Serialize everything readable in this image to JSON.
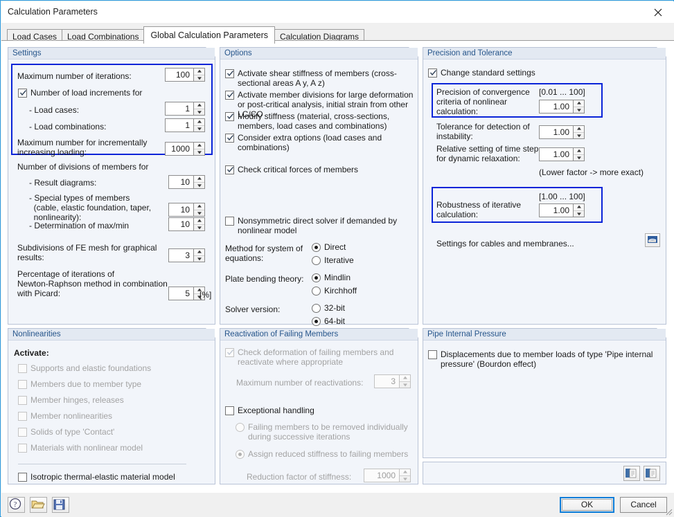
{
  "window": {
    "title": "Calculation Parameters",
    "close_icon": "close-icon"
  },
  "tabs": [
    {
      "label": "Load Cases",
      "active": false
    },
    {
      "label": "Load Combinations",
      "active": false
    },
    {
      "label": "Global Calculation Parameters",
      "active": true
    },
    {
      "label": "Calculation Diagrams",
      "active": false
    }
  ],
  "settings": {
    "title": "Settings",
    "max_iterations_label": "Maximum number of iterations:",
    "max_iterations_value": "100",
    "load_increments_label": "Number of load increments for",
    "load_increments_checked": true,
    "load_cases_label": "- Load cases:",
    "load_cases_value": "1",
    "load_combinations_label": "- Load combinations:",
    "load_combinations_value": "1",
    "max_incremental_label": "Maximum number for incrementally\nincreasing loading:",
    "max_incremental_value": "1000",
    "divisions_label": "Number of divisions of members for",
    "result_diagrams_label": "- Result diagrams:",
    "result_diagrams_value": "10",
    "special_types_label": "- Special types of members\n  (cable, elastic foundation, taper,\n  nonlinearity):",
    "special_types_value": "10",
    "maxmin_label": "- Determination of max/min",
    "maxmin_value": "10",
    "fe_mesh_label": "Subdivisions of FE mesh for graphical\nresults:",
    "fe_mesh_value": "3",
    "picard_label": "Percentage of iterations of\nNewton-Raphson method in combination\nwith Picard:",
    "picard_value": "5",
    "picard_unit": "[%]"
  },
  "options": {
    "title": "Options",
    "items": [
      {
        "label": "Activate shear stiffness of members\n(cross-sectional areas A y, A z)",
        "checked": true
      },
      {
        "label": "Activate member divisions for large deformation or\npost-critical analysis, initial strain from other LC/CO",
        "checked": true
      },
      {
        "label": "Modify stiffness (material, cross-sections, members,\nload cases and combinations)",
        "checked": true
      },
      {
        "label": "Consider extra options\n(load cases and combinations)",
        "checked": true
      },
      {
        "label": "Check critical forces of members",
        "checked": true
      },
      {
        "label": "Nonsymmetric direct solver if demanded by nonlinear\n    model",
        "checked": false
      }
    ],
    "method_label": "Method for system of\nequations:",
    "method_options": [
      "Direct",
      "Iterative"
    ],
    "method_selected": "Direct",
    "plate_label": "Plate bending theory:",
    "plate_options": [
      "Mindlin",
      "Kirchhoff"
    ],
    "plate_selected": "Mindlin",
    "solver_label": "Solver version:",
    "solver_options": [
      "32-bit",
      "64-bit"
    ],
    "solver_selected": "64-bit"
  },
  "precision": {
    "title": "Precision and Tolerance",
    "change_standard_label": "Change standard settings",
    "change_standard_checked": true,
    "convergence_label": "Precision of convergence\ncriteria of nonlinear\ncalculation:",
    "convergence_range": "[0.01 ... 100]",
    "convergence_value": "1.00",
    "instability_label": "Tolerance for detection of\ninstability:",
    "instability_value": "1.00",
    "timestep_label": "Relative setting of time step\nfor dynamic relaxation:",
    "timestep_value": "1.00",
    "timestep_note": "(Lower factor -> more exact)",
    "robustness_label": "Robustness of iterative\ncalculation:",
    "robustness_range": "[1.00 ... 100]",
    "robustness_value": "1.00",
    "cables_label": "Settings for cables and membranes...",
    "cables_icon": "cable-settings-icon",
    "highlight_color": "#0a24d8"
  },
  "nonlinearities": {
    "title": "Nonlinearities",
    "activate_label": "Activate:",
    "items": [
      {
        "label": "Supports and elastic foundations",
        "checked": false,
        "disabled": true
      },
      {
        "label": "Members due to member type",
        "checked": false,
        "disabled": true
      },
      {
        "label": "Member hinges, releases",
        "checked": false,
        "disabled": true
      },
      {
        "label": "Member nonlinearities",
        "checked": false,
        "disabled": true
      },
      {
        "label": "Solids of type 'Contact'",
        "checked": false,
        "disabled": true
      },
      {
        "label": "Materials with nonlinear model",
        "checked": false,
        "disabled": true
      }
    ],
    "thermal_label": "Isotropic thermal-elastic material model",
    "thermal_checked": false
  },
  "reactivation": {
    "title": "Reactivation of Failing Members",
    "check_deform_label": "Check deformation of failing members and\nreactivate where appropriate",
    "check_deform_checked": true,
    "check_deform_disabled": true,
    "max_reactivations_label": "Maximum number of reactivations:",
    "max_reactivations_value": "3",
    "exceptional_label": "Exceptional handling",
    "exceptional_checked": false,
    "remove_individually_label": "Failing members to be removed individually during\nsuccessive iterations",
    "remove_individually_selected": false,
    "assign_reduced_label": "Assign reduced stiffness to failing members",
    "assign_reduced_selected": true,
    "reduction_factor_label": "Reduction factor of stiffness:",
    "reduction_factor_value": "1000"
  },
  "pipe": {
    "title": "Pipe Internal Pressure",
    "displacement_label": "Displacements due to member loads of type 'Pipe internal\npressure' (Bourdon effect)",
    "displacement_checked": false,
    "copy_icon_1": "copy-to-icon",
    "copy_icon_2": "copy-from-icon"
  },
  "footer": {
    "help_icon": "help-icon",
    "open_icon": "open-folder-icon",
    "save_icon": "save-disk-icon",
    "ok_label": "OK",
    "cancel_label": "Cancel"
  }
}
